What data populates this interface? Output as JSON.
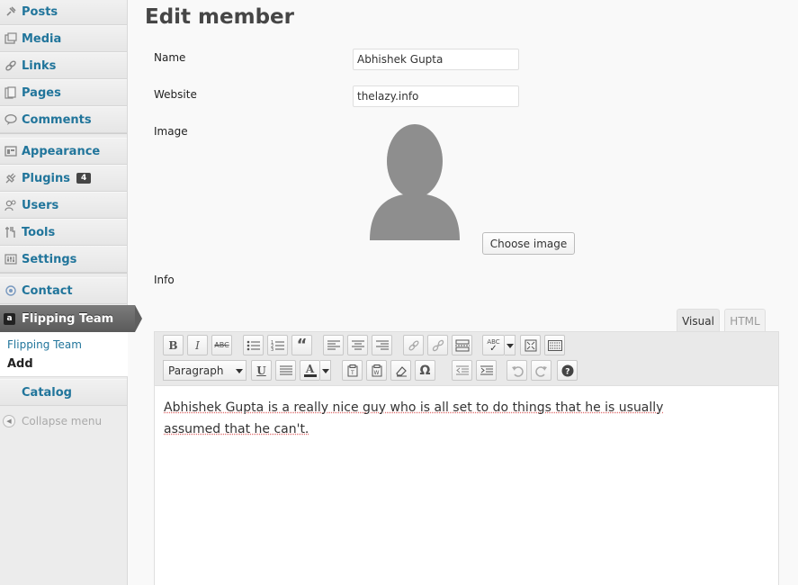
{
  "sidebar": {
    "items": [
      {
        "label": "Posts",
        "icon": "pin-icon"
      },
      {
        "label": "Media",
        "icon": "media-icon"
      },
      {
        "label": "Links",
        "icon": "links-icon"
      },
      {
        "label": "Pages",
        "icon": "pages-icon"
      },
      {
        "label": "Comments",
        "icon": "comments-icon"
      },
      {
        "label": "Appearance",
        "icon": "appearance-icon"
      },
      {
        "label": "Plugins",
        "icon": "plugins-icon",
        "badge": "4"
      },
      {
        "label": "Users",
        "icon": "users-icon"
      },
      {
        "label": "Tools",
        "icon": "tools-icon"
      },
      {
        "label": "Settings",
        "icon": "settings-icon"
      },
      {
        "label": "Contact",
        "icon": "contact-icon"
      }
    ],
    "active": {
      "label": "Flipping Team",
      "icon_glyph": "a"
    },
    "submenu": {
      "link": "Flipping Team",
      "current": "Add"
    },
    "catalog": "Catalog",
    "collapse": "Collapse menu"
  },
  "main": {
    "title": "Edit member",
    "fields": {
      "name_label": "Name",
      "name_value": "Abhishek Gupta",
      "website_label": "Website",
      "website_value": "thelazy.info",
      "image_label": "Image",
      "choose_image": "Choose image",
      "info_label": "Info"
    },
    "editor": {
      "tab_visual": "Visual",
      "tab_html": "HTML",
      "format": "Paragraph",
      "content": "Abhishek Gupta is a really nice guy who is all set to do things that he is usually assumed that he can't."
    }
  },
  "colors": {
    "link": "#21759b",
    "active_bg": "#6d6d6d"
  }
}
